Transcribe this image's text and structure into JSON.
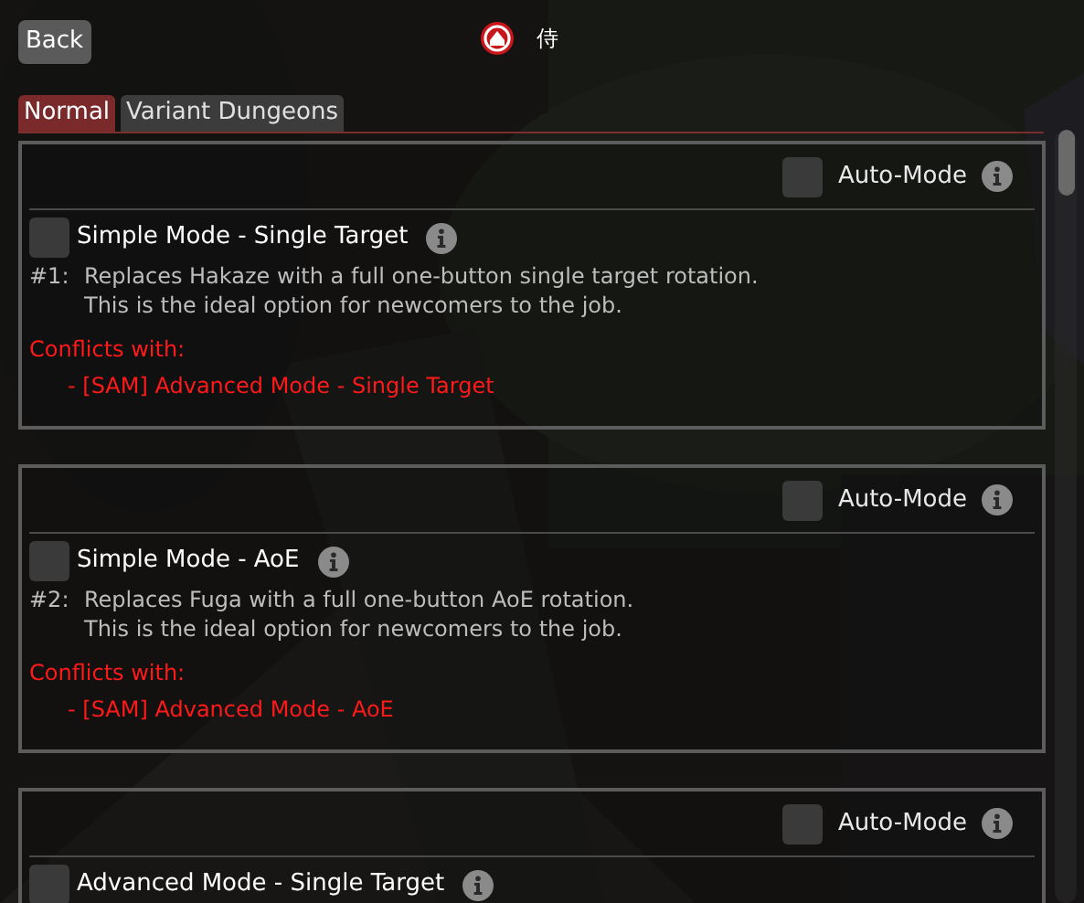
{
  "header": {
    "back_button": "Back",
    "title": "侍"
  },
  "tabs": [
    {
      "label": "Normal",
      "selected": true
    },
    {
      "label": "Variant Dungeons",
      "selected": false
    }
  ],
  "features": [
    {
      "auto_mode": {
        "label": "Auto-Mode",
        "checked": false
      },
      "title": "Simple Mode - Single Target",
      "checked": false,
      "number": "#1:",
      "description": [
        "Replaces Hakaze with a full one-button single target rotation.",
        "This is the ideal option for newcomers to the job."
      ],
      "conflicts_heading": "Conflicts with:",
      "conflicts": [
        "- [SAM] Advanced Mode - Single Target"
      ]
    },
    {
      "auto_mode": {
        "label": "Auto-Mode",
        "checked": false
      },
      "title": "Simple Mode - AoE",
      "checked": false,
      "number": "#2:",
      "description": [
        "Replaces Fuga with a full one-button AoE rotation.",
        "This is the ideal option for newcomers to the job."
      ],
      "conflicts_heading": "Conflicts with:",
      "conflicts": [
        "- [SAM] Advanced Mode - AoE"
      ]
    },
    {
      "auto_mode": {
        "label": "Auto-Mode",
        "checked": false
      },
      "title": "Advanced Mode - Single Target",
      "checked": false
    }
  ]
}
